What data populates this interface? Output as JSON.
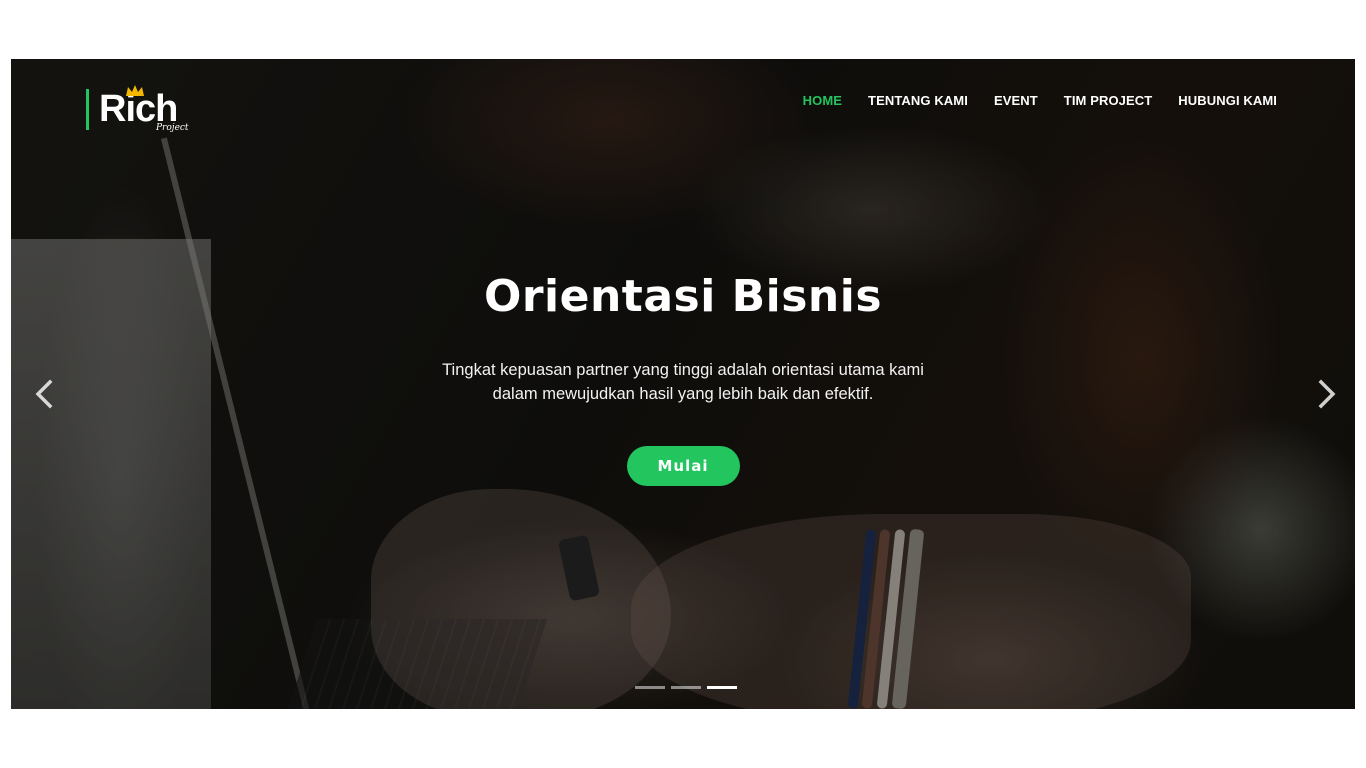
{
  "brand": {
    "name": "Rich",
    "tagline": "Project",
    "accent_color": "#22c55e"
  },
  "nav": {
    "items": [
      {
        "label": "HOME",
        "active": true
      },
      {
        "label": "TENTANG KAMI",
        "active": false
      },
      {
        "label": "EVENT",
        "active": false
      },
      {
        "label": "TIM PROJECT",
        "active": false
      },
      {
        "label": "HUBUNGI KAMI",
        "active": false
      }
    ]
  },
  "hero": {
    "title": "Orientasi Bisnis",
    "description": "Tingkat kepuasan partner yang tinggi adalah orientasi utama kami dalam mewujudkan hasil yang lebih baik dan efektif.",
    "button_label": "Mulai",
    "prev_icon": "chevron-left-icon",
    "next_icon": "chevron-right-icon",
    "slides_total": 3,
    "active_slide": 3
  }
}
